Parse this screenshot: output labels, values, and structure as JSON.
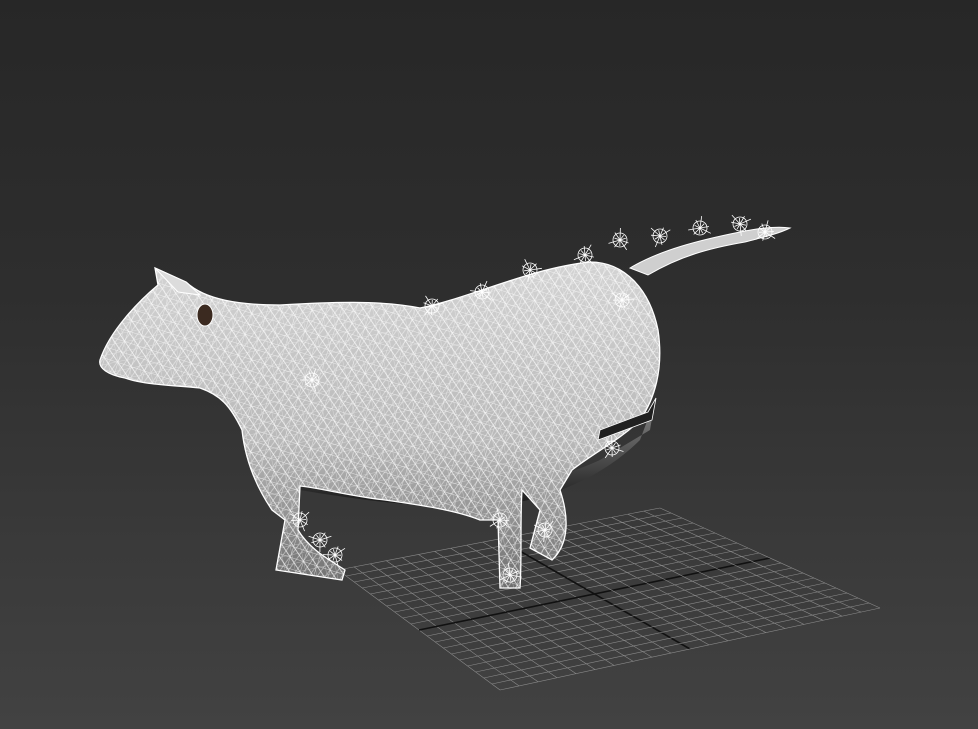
{
  "viewport": {
    "view": "perspective",
    "shading": "wireframe-over-shaded",
    "background_top": "#272727",
    "background_bottom": "#424242"
  },
  "home_grid": {
    "visible": true,
    "line_color": "#8a8a8a",
    "axis_color": "#111111"
  },
  "model": {
    "icon": "cow-mesh-icon",
    "wire_color": "#ffffff",
    "surface_color": "#c8c8c8",
    "selected": true
  }
}
